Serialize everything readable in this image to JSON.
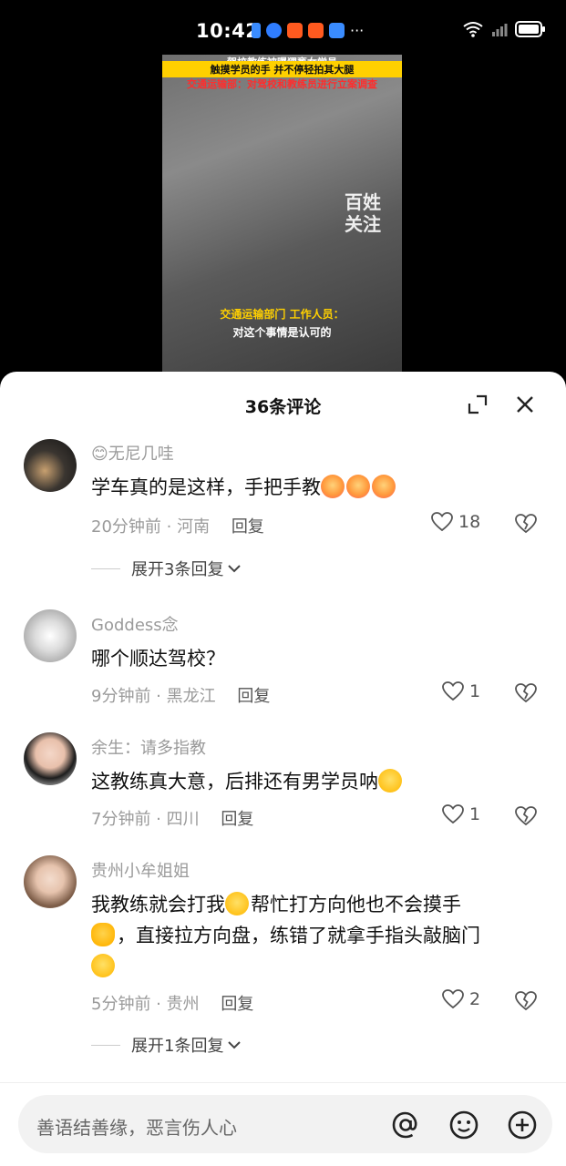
{
  "status": {
    "time": "10:42",
    "extra": "···"
  },
  "video": {
    "line1": "驾校教练被曝猥亵女学员",
    "line2": "触摸学员的手 并不停轻拍其大腿",
    "line3": "交通运输部：对驾校和教练员进行立案调查",
    "watermark_line1": "百姓",
    "watermark_line2": "关注",
    "caption1": "交通运输部门 工作人员：",
    "caption2": "对这个事情是认可的"
  },
  "sheet": {
    "title": "36条评论"
  },
  "comments": [
    {
      "username": "😊无尼几哇",
      "text": "学车真的是这样，手把手教",
      "time": "20分钟前",
      "location": "河南",
      "reply": "回复",
      "likes": "18",
      "expand": "展开3条回复"
    },
    {
      "username": "Goddess念",
      "text": "哪个顺达驾校？",
      "time": "9分钟前",
      "location": "黑龙江",
      "reply": "回复",
      "likes": "1"
    },
    {
      "username": "余生：请多指教",
      "text": "这教练真大意，后排还有男学员呐",
      "time": "7分钟前",
      "location": "四川",
      "reply": "回复",
      "likes": "1"
    },
    {
      "username": "贵州小牟姐姐",
      "text_a": "我教练就会打我",
      "text_b": "帮忙打方向他也不会摸手",
      "text_c": "，直接拉方向盘，练错了就拿手指头敲脑门",
      "time": "5分钟前",
      "location": "贵州",
      "reply": "回复",
      "likes": "2",
      "expand": "展开1条回复"
    }
  ],
  "input": {
    "placeholder": "善语结善缘，恶言伤人心"
  },
  "icons": {
    "expand": "expand-icon",
    "close": "close-icon",
    "like": "heart-icon",
    "dislike": "broken-heart-icon",
    "at": "at-icon",
    "emoji": "emoji-icon",
    "add": "plus-circle-icon"
  }
}
